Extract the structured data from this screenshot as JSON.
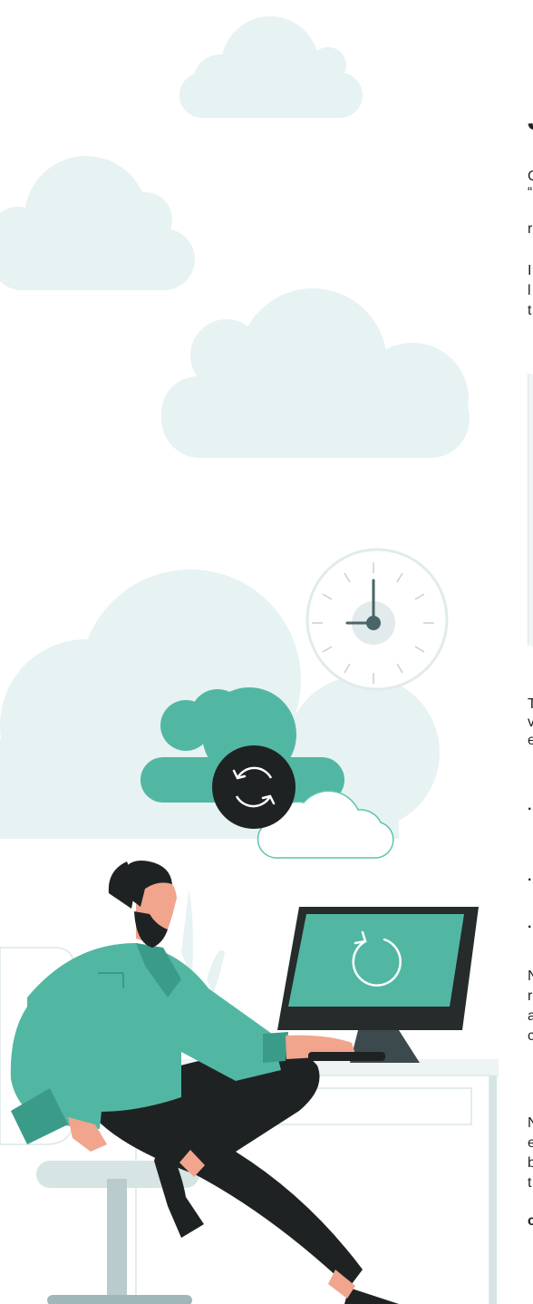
{
  "article": {
    "heading": "J",
    "paragraphs": [
      [
        "C",
        "“",
        "r"
      ],
      [
        "I",
        "l",
        "t"
      ],
      [
        "T",
        "v",
        "e"
      ],
      [
        "N",
        "r",
        "a",
        "c"
      ],
      [
        "N",
        "e",
        "b",
        "t",
        "c"
      ]
    ],
    "bullets": [
      "·",
      "·",
      "·"
    ]
  },
  "illustration": {
    "colors": {
      "cloud_light": "#e7f2f2",
      "teal": "#52b7a2",
      "teal_dark": "#3a9b88",
      "dark": "#1f2223",
      "skin": "#f0a58c",
      "desk": "#ffffff",
      "desk_edge": "#d6e4e4"
    },
    "icons": [
      "sync-icon",
      "refresh-icon",
      "clock-icon"
    ]
  }
}
